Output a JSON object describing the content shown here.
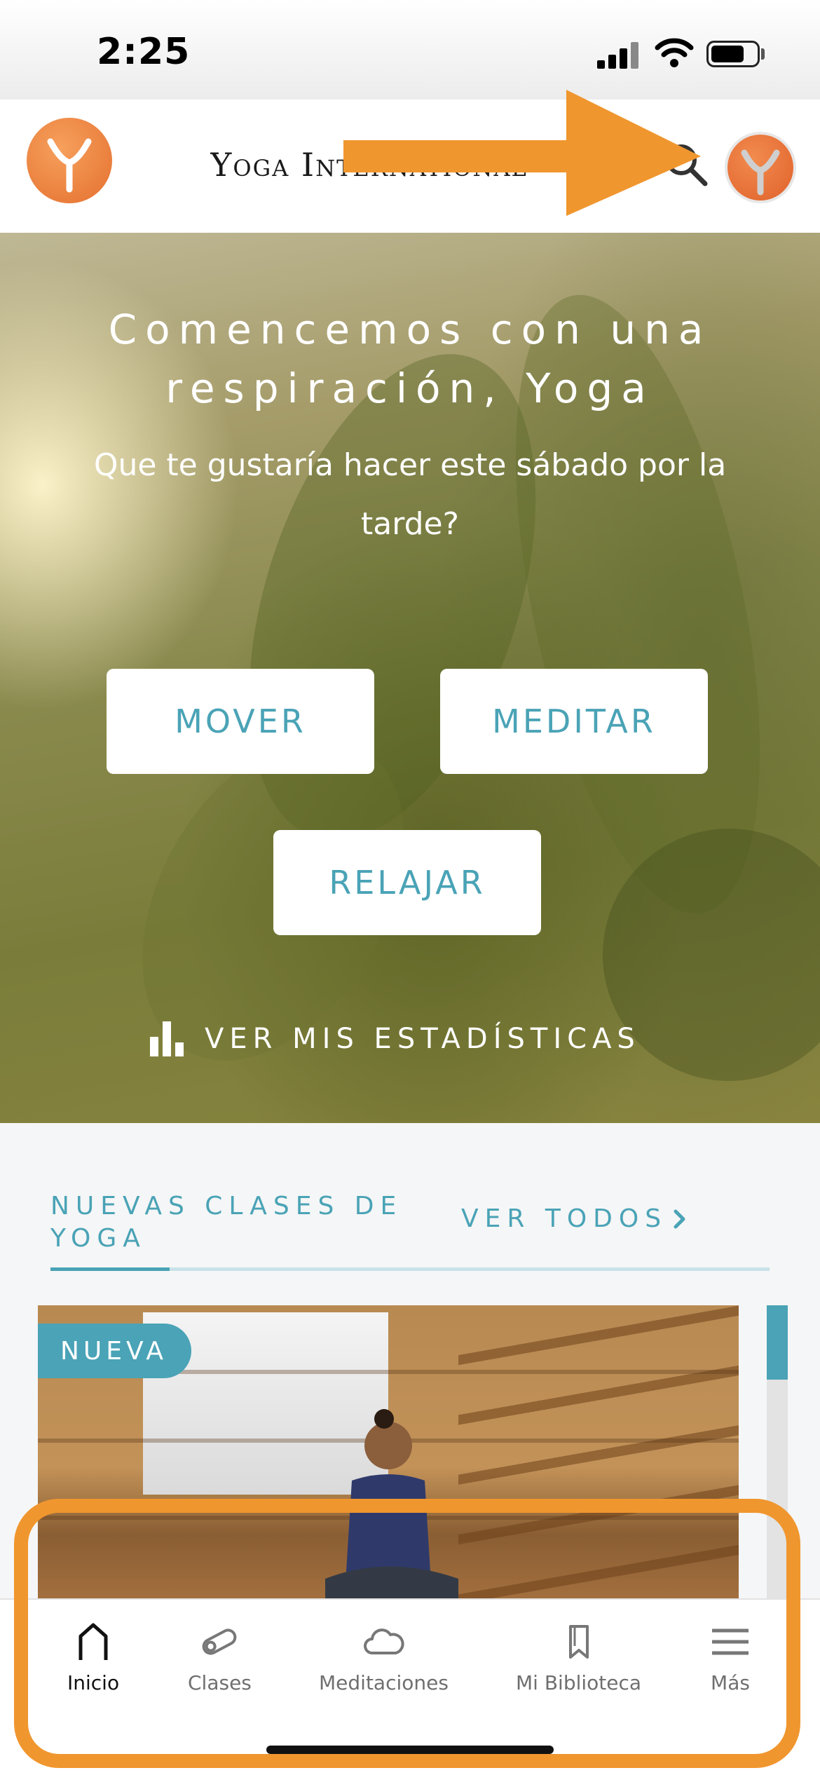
{
  "status_bar": {
    "time": "2:25"
  },
  "header": {
    "brand": "Yoga International",
    "logo_icon": "yoga-y-logo",
    "search_icon": "search-icon",
    "avatar_icon": "avatar"
  },
  "hero": {
    "title": "Comencemos con una respiración, Yoga",
    "subtitle": "Que te gustaría hacer este sábado por la tarde?",
    "buttons": {
      "move": "MOVER",
      "meditate": "MEDITAR",
      "relax": "RELAJAR"
    },
    "stats_link": "VER MIS ESTADÍSTICAS"
  },
  "section": {
    "title": "NUEVAS CLASES DE YOGA",
    "see_all": "VER TODOS"
  },
  "card": {
    "badge": "NUEVA"
  },
  "bottom_nav": {
    "items": [
      {
        "label": "Inicio",
        "icon": "home-icon"
      },
      {
        "label": "Clases",
        "icon": "mat-icon"
      },
      {
        "label": "Meditaciones",
        "icon": "cloud-icon"
      },
      {
        "label": "Mi Biblioteca",
        "icon": "bookmark-icon"
      },
      {
        "label": "Más",
        "icon": "menu-icon"
      }
    ]
  },
  "colors": {
    "accent": "#4aa3b6",
    "brand_orange": "#e5702f",
    "annotation": "#f0962e"
  }
}
